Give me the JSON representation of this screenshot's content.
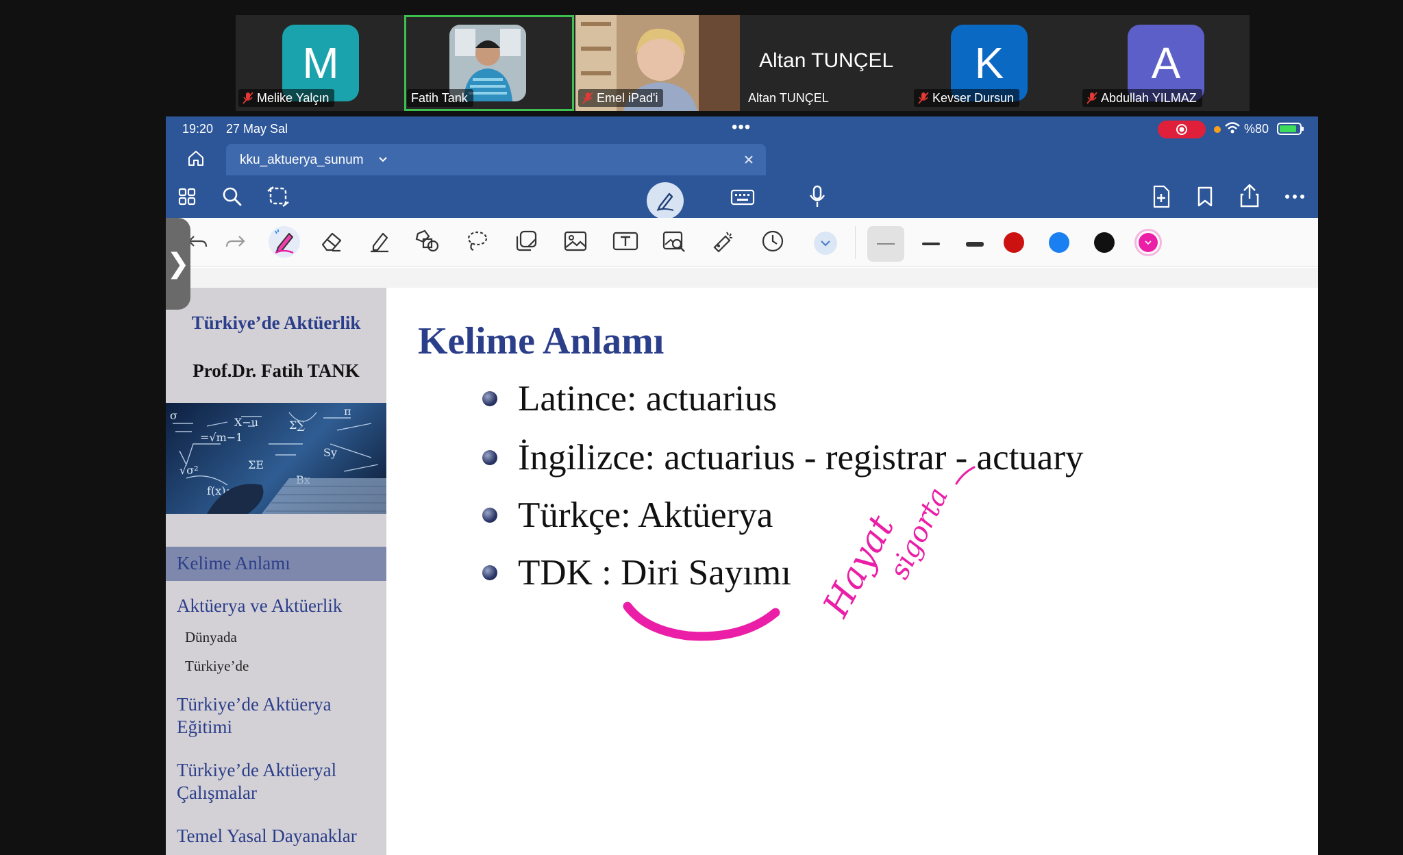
{
  "participants": [
    {
      "name": "Melike Yalçın",
      "initial": "M",
      "color": "#1aa3ac",
      "muted": true,
      "type": "avatar"
    },
    {
      "name": "Fatih Tank",
      "initial": "",
      "color": "#2a7fb0",
      "muted": false,
      "type": "photo",
      "active": true
    },
    {
      "name": "Emel iPad'i",
      "initial": "",
      "color": "#b79a7c",
      "muted": true,
      "type": "video"
    },
    {
      "name": "Altan TUNÇEL",
      "big_name": "Altan TUNÇEL",
      "muted": false,
      "type": "name"
    },
    {
      "name": "Kevser Dursun",
      "initial": "K",
      "color": "#0a69c3",
      "muted": true,
      "type": "avatar"
    },
    {
      "name": "Abdullah YILMAZ",
      "initial": "A",
      "color": "#5b5fc7",
      "muted": true,
      "type": "avatar"
    }
  ],
  "status_bar": {
    "time": "19:20",
    "date": "27 May Sal",
    "battery": "%80"
  },
  "tab": {
    "title": "kku_aktuerya_sunum"
  },
  "toolbar_icons": {
    "top_left": [
      "grid-icon",
      "search-icon",
      "lasso-icon"
    ],
    "center": [
      "pen-mode-icon",
      "keyboard-icon",
      "microphone-icon"
    ],
    "top_right": [
      "add-page-icon",
      "bookmark-icon",
      "share-icon",
      "more-icon"
    ]
  },
  "pen_colors": [
    "#cc1111",
    "#1a7ff0",
    "#111111",
    "#ea1ea7"
  ],
  "slide": {
    "sidebar": {
      "title": "Türkiye’de Aktüerlik",
      "author": "Prof.Dr. Fatih TANK",
      "nav": [
        {
          "label": "Kelime Anlamı",
          "active": true
        },
        {
          "label": "Aktüerya ve Aktüerlik"
        },
        {
          "label": "Dünyada",
          "sub": true
        },
        {
          "label": "Türkiye’de",
          "sub": true
        },
        {
          "label": "Türkiye’de Aktüerya Eğitimi"
        },
        {
          "label": "Türkiye’de Aktüeryal Çalışmalar"
        },
        {
          "label": "Temel Yasal Dayanaklar"
        }
      ]
    },
    "heading": "Kelime Anlamı",
    "bullets": [
      "Latince: actuarius",
      "İngilizce: actuarius - registrar - actuary",
      "Türkçe: Aktüerya",
      "TDK : Diri Sayımı"
    ],
    "handwriting": [
      "Hayat",
      "sigorta"
    ]
  },
  "accent_color": "#2d5699"
}
